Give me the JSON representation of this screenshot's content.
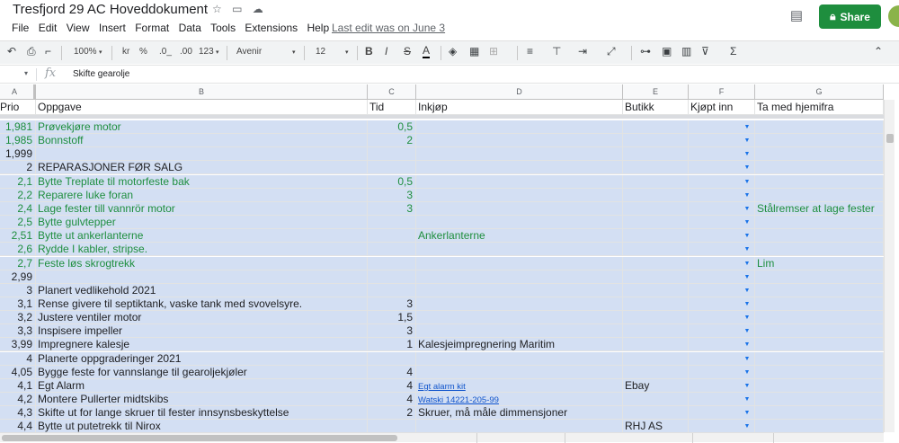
{
  "doc": {
    "title": "Tresfjord 29 AC Hoveddokument",
    "last_edit": "Last edit was on June 3"
  },
  "icons": {
    "star": "star-icon",
    "move": "folder-move-icon",
    "cloud": "cloud-status-icon",
    "comment": "comment-history-icon"
  },
  "menu": [
    "File",
    "Edit",
    "View",
    "Insert",
    "Format",
    "Data",
    "Tools",
    "Extensions",
    "Help"
  ],
  "share_label": "Share",
  "toolbar": {
    "zoom": "100%",
    "currency": "kr",
    "percent": "%",
    "dec_less": ".0_",
    "dec_more": ".00",
    "more_formats": "123",
    "font": "Avenir",
    "font_size": "12",
    "bold": "B",
    "italic": "I",
    "strike": "S",
    "textcolor": "A"
  },
  "formula": {
    "value": "Skifte gearolje"
  },
  "columns": [
    "A",
    "B",
    "C",
    "D",
    "E",
    "F",
    "G"
  ],
  "headers": {
    "prio": "Prio",
    "oppgave": "Oppgave",
    "tid": "Tid",
    "inkjop": "Inkjøp",
    "butikk": "Butikk",
    "kjopt": "Kjøpt inn",
    "tamed": "Ta med hjemifra"
  },
  "rows": [
    {
      "prio": "1,981",
      "task": "Prøvekjøre motor",
      "tid": "0,5",
      "green": true
    },
    {
      "prio": "1,985",
      "task": "Bonnstoff",
      "tid": "2",
      "green": true
    },
    {
      "prio": "1,999",
      "task": "",
      "tid": ""
    },
    {
      "prio": "2",
      "task": "REPARASJONER FØR SALG",
      "tid": ""
    },
    {
      "prio": "2,1",
      "task": "Bytte Treplate til motorfeste bak",
      "tid": "0,5",
      "green": true
    },
    {
      "prio": "2,2",
      "task": "Reparere luke foran",
      "tid": "3",
      "green": true
    },
    {
      "prio": "2,4",
      "task": "Lage fester till vannrör motor",
      "tid": "3",
      "green": true,
      "tamed": "Stålremser at lage fester"
    },
    {
      "prio": "2,5",
      "task": "Bytte gulvtepper",
      "tid": "",
      "green": true
    },
    {
      "prio": "2,51",
      "task": "Bytte ut ankerlanterne",
      "tid": "",
      "green": true,
      "inkjop": "Ankerlanterne"
    },
    {
      "prio": "2,6",
      "task": "Rydde I kabler, stripse.",
      "tid": "",
      "green": true
    },
    {
      "prio": "2,7",
      "task": "Feste løs skrogtrekk",
      "tid": "",
      "green": true,
      "tamed": "Lim"
    },
    {
      "prio": "2,99",
      "task": "",
      "tid": ""
    },
    {
      "prio": "3",
      "task": "Planert vedlikehold 2021",
      "tid": ""
    },
    {
      "prio": "3,1",
      "task": "Rense givere til septiktank, vaske tank med svovelsyre.",
      "tid": "3"
    },
    {
      "prio": "3,2",
      "task": "Justere ventiler motor",
      "tid": "1,5"
    },
    {
      "prio": "3,3",
      "task": "Inspisere impeller",
      "tid": "3"
    },
    {
      "prio": "3,99",
      "task": "Impregnere kalesje",
      "tid": "1",
      "inkjop": "Kalesjeimpregnering Maritim"
    },
    {
      "prio": "4",
      "task": "Planerte oppgraderinger 2021",
      "tid": ""
    },
    {
      "prio": "4,05",
      "task": "Bygge feste for vannslange til gearoljekjøler",
      "tid": "4"
    },
    {
      "prio": "4,1",
      "task": "Egt Alarm",
      "tid": "4",
      "inkjop": "Egt alarm kit",
      "link": true,
      "butikk": "Ebay"
    },
    {
      "prio": "4,2",
      "task": "Montere Pullerter  midtskibs",
      "tid": "4",
      "inkjop": "Watski 14221-205-99",
      "link": true
    },
    {
      "prio": "4,3",
      "task": "Skifte ut for lange skruer til fester innsynsbeskyttelse",
      "tid": "2",
      "inkjop": "Skruer, må måle dimmensjoner"
    },
    {
      "prio": "4,4",
      "task": "Bytte ut putetrekk til Nirox",
      "tid": "",
      "butikk": "RHJ AS"
    }
  ]
}
